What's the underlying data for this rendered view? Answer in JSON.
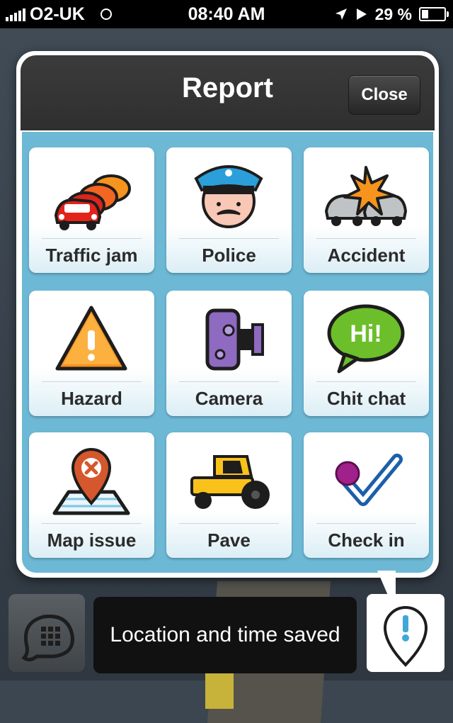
{
  "status_bar": {
    "carrier": "O2-UK",
    "time": "08:40 AM",
    "battery": "29 %",
    "battery_level": 0.29
  },
  "dialog": {
    "title": "Report",
    "close_label": "Close"
  },
  "report_items": [
    {
      "label": "Traffic jam",
      "icon": "traffic-jam-icon"
    },
    {
      "label": "Police",
      "icon": "police-icon"
    },
    {
      "label": "Accident",
      "icon": "accident-icon"
    },
    {
      "label": "Hazard",
      "icon": "hazard-icon"
    },
    {
      "label": "Camera",
      "icon": "camera-icon"
    },
    {
      "label": "Chit chat",
      "icon": "chit-chat-icon"
    },
    {
      "label": "Map issue",
      "icon": "map-issue-icon"
    },
    {
      "label": "Pave",
      "icon": "pave-icon"
    },
    {
      "label": "Check in",
      "icon": "check-in-icon"
    }
  ],
  "chit_chat_bubble_text": "Hi!",
  "toast": {
    "message": "Location and time saved"
  },
  "colors": {
    "grid_background": "#6cb8d5",
    "header": "#2f2f2f",
    "accent_orange": "#f7941d"
  }
}
